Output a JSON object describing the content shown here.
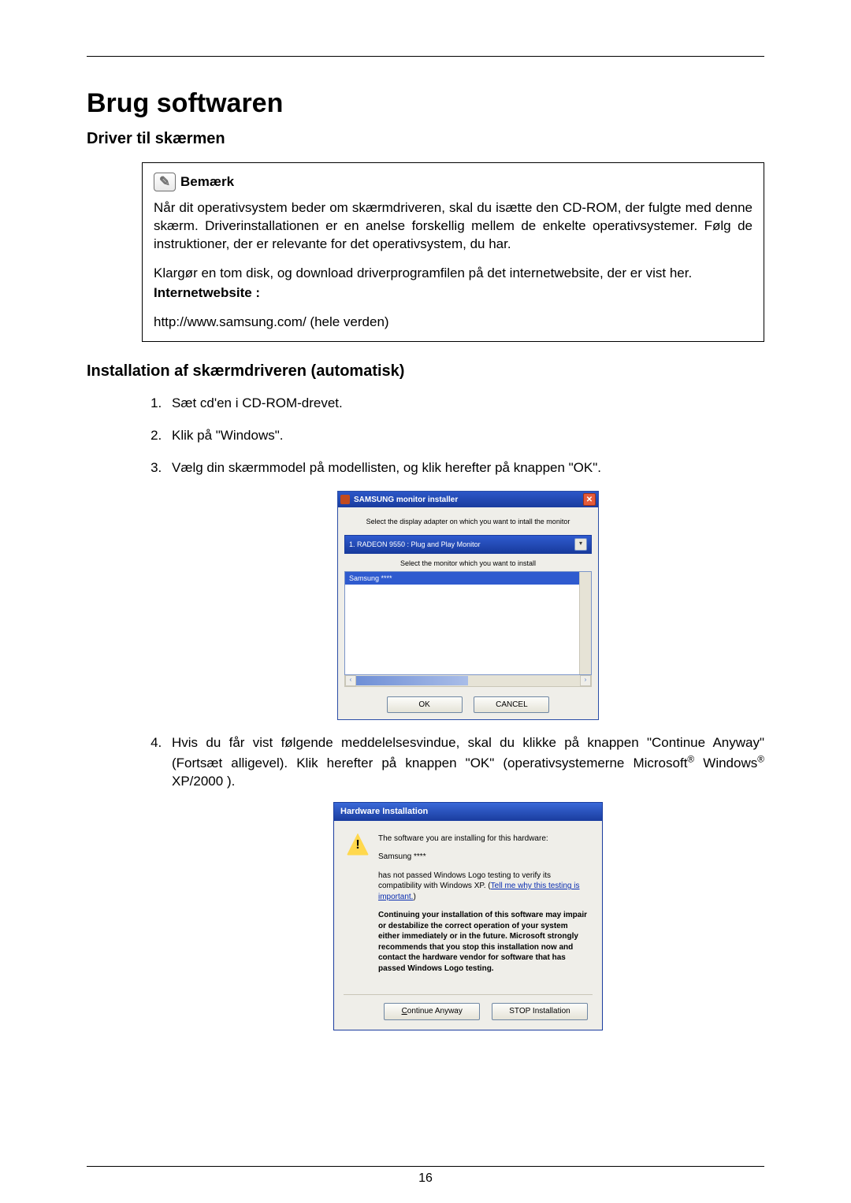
{
  "page_number": "16",
  "h1": "Brug softwaren",
  "h2_driver": "Driver til skærmen",
  "note": {
    "label": "Bemærk",
    "icon_glyph": "✎",
    "p1": "Når dit operativsystem beder om skærmdriveren, skal du isætte den CD-ROM, der fulgte med denne skærm. Driverinstallationen er en anelse forskellig mellem de enkelte operativsystemer. Følg de instruktioner, der er relevante for det operativsystem, du har.",
    "p2": "Klargør en tom disk, og download driverprogramfilen på det internetwebsite, der er vist her.",
    "site_label": "Internetwebsite :",
    "site_url": "http://www.samsung.com/ (hele verden)"
  },
  "h2_install": "Installation af skærmdriveren (automatisk)",
  "steps": [
    "Sæt cd'en i CD-ROM-drevet.",
    "Klik på \"Windows\".",
    "Vælg din skærmmodel på modellisten, og klik herefter på knappen \"OK\".",
    "Hvis du får vist følgende meddelelsesvindue, skal du klikke på knappen \"Continue Anyway\" (Fortsæt alligevel). Klik herefter på knappen \"OK\" (operativsystemerne Microsoft® Windows® XP/2000 )."
  ],
  "dlg1": {
    "title": "SAMSUNG monitor installer",
    "close_glyph": "✕",
    "instr1": "Select the display adapter on which you want to intall the monitor",
    "adapter": "1. RADEON 9550 : Plug and Play Monitor",
    "dropdown_glyph": "▾",
    "instr2": "Select the monitor which you want to install",
    "item": "Samsung ****",
    "left_glyph": "‹",
    "right_glyph": "›",
    "ok": "OK",
    "cancel": "CANCEL"
  },
  "dlg2": {
    "title": "Hardware Installation",
    "p1": "The software you are installing for this hardware:",
    "p2": "Samsung ****",
    "p3a": "has not passed Windows Logo testing to verify its compatibility with Windows XP. (",
    "link": "Tell me why this testing is important.",
    "p3b": ")",
    "p4": "Continuing your installation of this software may impair or destabilize the correct operation of your system either immediately or in the future. Microsoft strongly recommends that you stop this installation now and contact the hardware vendor for software that has passed Windows Logo testing.",
    "btn_continue": "Continue Anyway",
    "btn_stop": "STOP Installation",
    "continue_underline_char": "C"
  }
}
